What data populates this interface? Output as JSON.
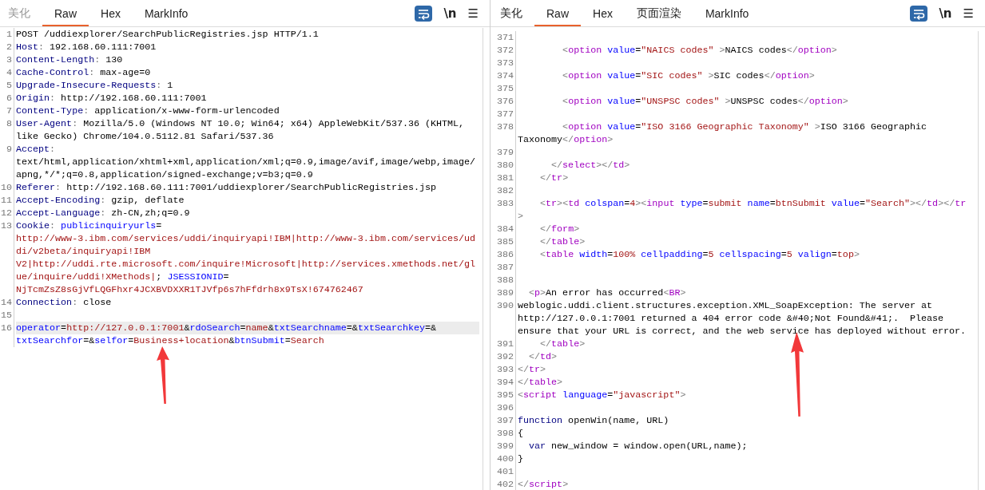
{
  "panes": [
    {
      "tabs": [
        {
          "label": "美化",
          "selected": false,
          "disabled": true
        },
        {
          "label": "Raw",
          "selected": true,
          "disabled": false
        },
        {
          "label": "Hex",
          "selected": false,
          "disabled": false
        },
        {
          "label": "MarkInfo",
          "selected": false,
          "disabled": false
        }
      ],
      "wrap_on": true,
      "newline_label": "\\n",
      "menu_glyph": "☰",
      "top_offset": false,
      "annotation_arrow": true,
      "lines": [
        {
          "number": "1",
          "current": false,
          "rows": [
            {
              "segments": [
                {
                  "text": "POST /uddiexplorer/SearchPublicRegistries.jsp HTTP/1.1",
                  "kind": "plain"
                }
              ]
            }
          ]
        },
        {
          "number": "2",
          "current": false,
          "rows": [
            {
              "segments": [
                {
                  "text": "Host",
                  "kind": "key"
                },
                {
                  "text": ":",
                  "kind": "punct"
                },
                {
                  "text": " 192.168.60.111:7001",
                  "kind": "plain"
                }
              ]
            }
          ]
        },
        {
          "number": "3",
          "current": false,
          "rows": [
            {
              "segments": [
                {
                  "text": "Content-Length",
                  "kind": "key"
                },
                {
                  "text": ":",
                  "kind": "punct"
                },
                {
                  "text": " 130",
                  "kind": "plain"
                }
              ]
            }
          ]
        },
        {
          "number": "4",
          "current": false,
          "rows": [
            {
              "segments": [
                {
                  "text": "Cache-Control",
                  "kind": "key"
                },
                {
                  "text": ":",
                  "kind": "punct"
                },
                {
                  "text": " max-age=0",
                  "kind": "plain"
                }
              ]
            }
          ]
        },
        {
          "number": "5",
          "current": false,
          "rows": [
            {
              "segments": [
                {
                  "text": "Upgrade-Insecure-Requests",
                  "kind": "key"
                },
                {
                  "text": ":",
                  "kind": "punct"
                },
                {
                  "text": " 1",
                  "kind": "plain"
                }
              ]
            }
          ]
        },
        {
          "number": "6",
          "current": false,
          "rows": [
            {
              "segments": [
                {
                  "text": "Origin",
                  "kind": "key"
                },
                {
                  "text": ":",
                  "kind": "punct"
                },
                {
                  "text": " http://192.168.60.111:7001",
                  "kind": "plain"
                }
              ]
            }
          ]
        },
        {
          "number": "7",
          "current": false,
          "rows": [
            {
              "segments": [
                {
                  "text": "Content-Type",
                  "kind": "key"
                },
                {
                  "text": ":",
                  "kind": "punct"
                },
                {
                  "text": " application/x-www-form-urlencoded",
                  "kind": "plain"
                }
              ]
            }
          ]
        },
        {
          "number": "8",
          "current": false,
          "rows": [
            {
              "segments": [
                {
                  "text": "User-Agent",
                  "kind": "key"
                },
                {
                  "text": ":",
                  "kind": "punct"
                },
                {
                  "text": " Mozilla/5.0 (Windows NT 10.0; Win64; x64) AppleWebKit/537.36 (KHTML,",
                  "kind": "plain"
                }
              ]
            },
            {
              "segments": [
                {
                  "text": "like Gecko) Chrome/104.0.5112.81 Safari/537.36",
                  "kind": "plain"
                }
              ]
            }
          ]
        },
        {
          "number": "9",
          "current": false,
          "rows": [
            {
              "segments": [
                {
                  "text": "Accept",
                  "kind": "key"
                },
                {
                  "text": ":",
                  "kind": "punct"
                }
              ]
            },
            {
              "segments": [
                {
                  "text": "text/html,application/xhtml+xml,application/xml;q=0.9,image/avif,image/webp,image/",
                  "kind": "plain"
                }
              ]
            },
            {
              "segments": [
                {
                  "text": "apng,*/*;q=0.8,application/signed-exchange;v=b3;q=0.9",
                  "kind": "plain"
                }
              ]
            }
          ]
        },
        {
          "number": "10",
          "current": false,
          "rows": [
            {
              "segments": [
                {
                  "text": "Referer",
                  "kind": "key"
                },
                {
                  "text": ":",
                  "kind": "punct"
                },
                {
                  "text": " http://192.168.60.111:7001/uddiexplorer/SearchPublicRegistries.jsp",
                  "kind": "plain"
                }
              ]
            }
          ]
        },
        {
          "number": "11",
          "current": false,
          "rows": [
            {
              "segments": [
                {
                  "text": "Accept-Encoding",
                  "kind": "key"
                },
                {
                  "text": ":",
                  "kind": "punct"
                },
                {
                  "text": " gzip, deflate",
                  "kind": "plain"
                }
              ]
            }
          ]
        },
        {
          "number": "12",
          "current": false,
          "rows": [
            {
              "segments": [
                {
                  "text": "Accept-Language",
                  "kind": "key"
                },
                {
                  "text": ":",
                  "kind": "punct"
                },
                {
                  "text": " zh-CN,zh;q=0.9",
                  "kind": "plain"
                }
              ]
            }
          ]
        },
        {
          "number": "13",
          "current": false,
          "rows": [
            {
              "segments": [
                {
                  "text": "Cookie",
                  "kind": "key"
                },
                {
                  "text": ":",
                  "kind": "punct"
                },
                {
                  "text": " publicinquiryurls",
                  "kind": "name"
                },
                {
                  "text": "=",
                  "kind": "plain"
                }
              ]
            },
            {
              "segments": [
                {
                  "text": "http://www-3.ibm.com/services/uddi/inquiryapi!IBM|http://www-3.ibm.com/services/ud",
                  "kind": "value"
                }
              ]
            },
            {
              "segments": [
                {
                  "text": "di/v2beta/inquiryapi!IBM",
                  "kind": "value"
                }
              ]
            },
            {
              "segments": [
                {
                  "text": "V2|http://uddi.rte.microsoft.com/inquire!Microsoft|http://services.xmethods.net/gl",
                  "kind": "value"
                }
              ]
            },
            {
              "segments": [
                {
                  "text": "ue/inquire/uddi!XMethods|",
                  "kind": "value"
                },
                {
                  "text": "; ",
                  "kind": "plain"
                },
                {
                  "text": "JSESSIONID",
                  "kind": "name"
                },
                {
                  "text": "=",
                  "kind": "plain"
                }
              ]
            },
            {
              "segments": [
                {
                  "text": "NjTcmZsZ8sGjVfLQGFhxr4JCXBVDXXR1TJVfp6s7hFfdrh8x9TsX!674762467",
                  "kind": "value"
                }
              ]
            }
          ]
        },
        {
          "number": "14",
          "current": false,
          "rows": [
            {
              "segments": [
                {
                  "text": "Connection",
                  "kind": "key"
                },
                {
                  "text": ":",
                  "kind": "punct"
                },
                {
                  "text": " close",
                  "kind": "plain"
                }
              ]
            }
          ]
        },
        {
          "number": "15",
          "current": false,
          "rows": [
            {}
          ]
        },
        {
          "number": "16",
          "current": true,
          "rows": [
            {
              "segments": [
                {
                  "text": "operator",
                  "kind": "name"
                },
                {
                  "text": "=",
                  "kind": "plain"
                },
                {
                  "text": "http://127.0.0.1:7001",
                  "kind": "value"
                },
                {
                  "text": "&",
                  "kind": "plain"
                },
                {
                  "text": "rdoSearch",
                  "kind": "name"
                },
                {
                  "text": "=",
                  "kind": "plain"
                },
                {
                  "text": "name",
                  "kind": "value"
                },
                {
                  "text": "&",
                  "kind": "plain"
                },
                {
                  "text": "txtSearchname",
                  "kind": "name"
                },
                {
                  "text": "=&",
                  "kind": "plain"
                },
                {
                  "text": "txtSearchkey",
                  "kind": "name"
                },
                {
                  "text": "=&",
                  "kind": "plain"
                }
              ]
            },
            {
              "segments": [
                {
                  "text": "txtSearchfor",
                  "kind": "name"
                },
                {
                  "text": "=&",
                  "kind": "plain"
                },
                {
                  "text": "selfor",
                  "kind": "name"
                },
                {
                  "text": "=",
                  "kind": "plain"
                },
                {
                  "text": "Business+location",
                  "kind": "value"
                },
                {
                  "text": "&",
                  "kind": "plain"
                },
                {
                  "text": "btnSubmit",
                  "kind": "name"
                },
                {
                  "text": "=",
                  "kind": "plain"
                },
                {
                  "text": "Search",
                  "kind": "value"
                }
              ]
            }
          ]
        }
      ]
    },
    {
      "tabs": [
        {
          "label": "美化",
          "selected": false,
          "disabled": false
        },
        {
          "label": "Raw",
          "selected": true,
          "disabled": false
        },
        {
          "label": "Hex",
          "selected": false,
          "disabled": false
        },
        {
          "label": "页面渲染",
          "selected": false,
          "disabled": false
        },
        {
          "label": "MarkInfo",
          "selected": false,
          "disabled": false
        }
      ],
      "wrap_on": true,
      "newline_label": "\\n",
      "menu_glyph": "☰",
      "top_offset": true,
      "annotation_arrow": true,
      "lines": [
        {
          "number": "371",
          "current": false,
          "rows": [
            {}
          ]
        },
        {
          "number": "372",
          "current": false,
          "rows": [
            {
              "segments": [
                {
                  "text": "        <",
                  "kind": "bracket"
                },
                {
                  "text": "option",
                  "kind": "tag"
                },
                {
                  "text": " value",
                  "kind": "attr"
                },
                {
                  "text": "=",
                  "kind": "plain"
                },
                {
                  "text": "\"NAICS codes\"",
                  "kind": "value"
                },
                {
                  "text": " >",
                  "kind": "bracket"
                },
                {
                  "text": "NAICS codes",
                  "kind": "plain"
                },
                {
                  "text": "</",
                  "kind": "bracket"
                },
                {
                  "text": "option",
                  "kind": "tag"
                },
                {
                  "text": ">",
                  "kind": "bracket"
                }
              ]
            }
          ]
        },
        {
          "number": "373",
          "current": false,
          "rows": [
            {}
          ]
        },
        {
          "number": "374",
          "current": false,
          "rows": [
            {
              "segments": [
                {
                  "text": "        <",
                  "kind": "bracket"
                },
                {
                  "text": "option",
                  "kind": "tag"
                },
                {
                  "text": " value",
                  "kind": "attr"
                },
                {
                  "text": "=",
                  "kind": "plain"
                },
                {
                  "text": "\"SIC codes\"",
                  "kind": "value"
                },
                {
                  "text": " >",
                  "kind": "bracket"
                },
                {
                  "text": "SIC codes",
                  "kind": "plain"
                },
                {
                  "text": "</",
                  "kind": "bracket"
                },
                {
                  "text": "option",
                  "kind": "tag"
                },
                {
                  "text": ">",
                  "kind": "bracket"
                }
              ]
            }
          ]
        },
        {
          "number": "375",
          "current": false,
          "rows": [
            {}
          ]
        },
        {
          "number": "376",
          "current": false,
          "rows": [
            {
              "segments": [
                {
                  "text": "        <",
                  "kind": "bracket"
                },
                {
                  "text": "option",
                  "kind": "tag"
                },
                {
                  "text": " value",
                  "kind": "attr"
                },
                {
                  "text": "=",
                  "kind": "plain"
                },
                {
                  "text": "\"UNSPSC codes\"",
                  "kind": "value"
                },
                {
                  "text": " >",
                  "kind": "bracket"
                },
                {
                  "text": "UNSPSC codes",
                  "kind": "plain"
                },
                {
                  "text": "</",
                  "kind": "bracket"
                },
                {
                  "text": "option",
                  "kind": "tag"
                },
                {
                  "text": ">",
                  "kind": "bracket"
                }
              ]
            }
          ]
        },
        {
          "number": "377",
          "current": false,
          "rows": [
            {}
          ]
        },
        {
          "number": "378",
          "current": false,
          "rows": [
            {
              "segments": [
                {
                  "text": "        <",
                  "kind": "bracket"
                },
                {
                  "text": "option",
                  "kind": "tag"
                },
                {
                  "text": " value",
                  "kind": "attr"
                },
                {
                  "text": "=",
                  "kind": "plain"
                },
                {
                  "text": "\"ISO 3166 Geographic Taxonomy\"",
                  "kind": "value"
                },
                {
                  "text": " >",
                  "kind": "bracket"
                },
                {
                  "text": "ISO 3166 Geographic",
                  "kind": "plain"
                }
              ]
            },
            {
              "segments": [
                {
                  "text": "Taxonomy",
                  "kind": "plain"
                },
                {
                  "text": "</",
                  "kind": "bracket"
                },
                {
                  "text": "option",
                  "kind": "tag"
                },
                {
                  "text": ">",
                  "kind": "bracket"
                }
              ]
            }
          ]
        },
        {
          "number": "379",
          "current": false,
          "rows": [
            {}
          ]
        },
        {
          "number": "380",
          "current": false,
          "rows": [
            {
              "segments": [
                {
                  "text": "      </",
                  "kind": "bracket"
                },
                {
                  "text": "select",
                  "kind": "tag"
                },
                {
                  "text": ">",
                  "kind": "bracket"
                },
                {
                  "text": "</",
                  "kind": "bracket"
                },
                {
                  "text": "td",
                  "kind": "tag"
                },
                {
                  "text": ">",
                  "kind": "bracket"
                }
              ]
            }
          ]
        },
        {
          "number": "381",
          "current": false,
          "rows": [
            {
              "segments": [
                {
                  "text": "    </",
                  "kind": "bracket"
                },
                {
                  "text": "tr",
                  "kind": "tag"
                },
                {
                  "text": ">",
                  "kind": "bracket"
                }
              ]
            }
          ]
        },
        {
          "number": "382",
          "current": false,
          "rows": [
            {}
          ]
        },
        {
          "number": "383",
          "current": false,
          "rows": [
            {
              "segments": [
                {
                  "text": "    <",
                  "kind": "bracket"
                },
                {
                  "text": "tr",
                  "kind": "tag"
                },
                {
                  "text": ">",
                  "kind": "bracket"
                },
                {
                  "text": "<",
                  "kind": "bracket"
                },
                {
                  "text": "td",
                  "kind": "tag"
                },
                {
                  "text": " colspan",
                  "kind": "attr"
                },
                {
                  "text": "=",
                  "kind": "plain"
                },
                {
                  "text": "4",
                  "kind": "value"
                },
                {
                  "text": ">",
                  "kind": "bracket"
                },
                {
                  "text": "<",
                  "kind": "bracket"
                },
                {
                  "text": "input",
                  "kind": "tag"
                },
                {
                  "text": " type",
                  "kind": "attr"
                },
                {
                  "text": "=",
                  "kind": "plain"
                },
                {
                  "text": "submit",
                  "kind": "value"
                },
                {
                  "text": " name",
                  "kind": "attr"
                },
                {
                  "text": "=",
                  "kind": "plain"
                },
                {
                  "text": "btnSubmit",
                  "kind": "value"
                },
                {
                  "text": " value",
                  "kind": "attr"
                },
                {
                  "text": "=",
                  "kind": "plain"
                },
                {
                  "text": "\"Search\"",
                  "kind": "value"
                },
                {
                  "text": ">",
                  "kind": "bracket"
                },
                {
                  "text": "</",
                  "kind": "bracket"
                },
                {
                  "text": "td",
                  "kind": "tag"
                },
                {
                  "text": ">",
                  "kind": "bracket"
                },
                {
                  "text": "</",
                  "kind": "bracket"
                },
                {
                  "text": "tr",
                  "kind": "tag"
                }
              ]
            },
            {
              "segments": [
                {
                  "text": ">",
                  "kind": "bracket"
                }
              ]
            }
          ]
        },
        {
          "number": "384",
          "current": false,
          "rows": [
            {
              "segments": [
                {
                  "text": "    </",
                  "kind": "bracket"
                },
                {
                  "text": "form",
                  "kind": "tag"
                },
                {
                  "text": ">",
                  "kind": "bracket"
                }
              ]
            }
          ]
        },
        {
          "number": "385",
          "current": false,
          "rows": [
            {
              "segments": [
                {
                  "text": "    </",
                  "kind": "bracket"
                },
                {
                  "text": "table",
                  "kind": "tag"
                },
                {
                  "text": ">",
                  "kind": "bracket"
                }
              ]
            }
          ]
        },
        {
          "number": "386",
          "current": false,
          "rows": [
            {
              "segments": [
                {
                  "text": "    <",
                  "kind": "bracket"
                },
                {
                  "text": "table",
                  "kind": "tag"
                },
                {
                  "text": " width",
                  "kind": "attr"
                },
                {
                  "text": "=",
                  "kind": "plain"
                },
                {
                  "text": "100%",
                  "kind": "value"
                },
                {
                  "text": " cellpadding",
                  "kind": "attr"
                },
                {
                  "text": "=",
                  "kind": "plain"
                },
                {
                  "text": "5",
                  "kind": "value"
                },
                {
                  "text": " cellspacing",
                  "kind": "attr"
                },
                {
                  "text": "=",
                  "kind": "plain"
                },
                {
                  "text": "5",
                  "kind": "value"
                },
                {
                  "text": " valign",
                  "kind": "attr"
                },
                {
                  "text": "=",
                  "kind": "plain"
                },
                {
                  "text": "top",
                  "kind": "value"
                },
                {
                  "text": ">",
                  "kind": "bracket"
                }
              ]
            }
          ]
        },
        {
          "number": "387",
          "current": false,
          "rows": [
            {}
          ]
        },
        {
          "number": "388",
          "current": false,
          "rows": [
            {}
          ]
        },
        {
          "number": "389",
          "current": false,
          "rows": [
            {
              "segments": [
                {
                  "text": "  <",
                  "kind": "bracket"
                },
                {
                  "text": "p",
                  "kind": "tag"
                },
                {
                  "text": ">",
                  "kind": "bracket"
                },
                {
                  "text": "An error has occurred",
                  "kind": "plain"
                },
                {
                  "text": "<",
                  "kind": "bracket"
                },
                {
                  "text": "BR",
                  "kind": "tag"
                },
                {
                  "text": ">",
                  "kind": "bracket"
                }
              ]
            }
          ]
        },
        {
          "number": "390",
          "current": false,
          "rows": [
            {
              "segments": [
                {
                  "text": "weblogic.uddi.client.structures.exception.XML_SoapException: The server at",
                  "kind": "plain"
                }
              ]
            },
            {
              "segments": [
                {
                  "text": "http://127.0.0.1:7001 returned a 404 error code &#40;Not Found&#41;.  Please",
                  "kind": "plain"
                }
              ]
            },
            {
              "segments": [
                {
                  "text": "ensure that your URL is correct, and the web service has deployed without error.",
                  "kind": "plain"
                }
              ]
            }
          ]
        },
        {
          "number": "391",
          "current": false,
          "rows": [
            {
              "segments": [
                {
                  "text": "    </",
                  "kind": "bracket"
                },
                {
                  "text": "table",
                  "kind": "tag"
                },
                {
                  "text": ">",
                  "kind": "bracket"
                }
              ]
            }
          ]
        },
        {
          "number": "392",
          "current": false,
          "rows": [
            {
              "segments": [
                {
                  "text": "  </",
                  "kind": "bracket"
                },
                {
                  "text": "td",
                  "kind": "tag"
                },
                {
                  "text": ">",
                  "kind": "bracket"
                }
              ]
            }
          ]
        },
        {
          "number": "393",
          "current": false,
          "rows": [
            {
              "segments": [
                {
                  "text": "</",
                  "kind": "bracket"
                },
                {
                  "text": "tr",
                  "kind": "tag"
                },
                {
                  "text": ">",
                  "kind": "bracket"
                }
              ]
            }
          ]
        },
        {
          "number": "394",
          "current": false,
          "rows": [
            {
              "segments": [
                {
                  "text": "</",
                  "kind": "bracket"
                },
                {
                  "text": "table",
                  "kind": "tag"
                },
                {
                  "text": ">",
                  "kind": "bracket"
                }
              ]
            }
          ]
        },
        {
          "number": "395",
          "current": false,
          "rows": [
            {
              "segments": [
                {
                  "text": "<",
                  "kind": "bracket"
                },
                {
                  "text": "script",
                  "kind": "tag"
                },
                {
                  "text": " language",
                  "kind": "attr"
                },
                {
                  "text": "=",
                  "kind": "plain"
                },
                {
                  "text": "\"javascript\"",
                  "kind": "value"
                },
                {
                  "text": ">",
                  "kind": "bracket"
                }
              ]
            }
          ]
        },
        {
          "number": "396",
          "current": false,
          "rows": [
            {}
          ]
        },
        {
          "number": "397",
          "current": false,
          "rows": [
            {
              "segments": [
                {
                  "text": "function",
                  "kind": "key"
                },
                {
                  "text": " openWin(name, URL)",
                  "kind": "plain"
                }
              ]
            }
          ]
        },
        {
          "number": "398",
          "current": false,
          "rows": [
            {
              "segments": [
                {
                  "text": "{",
                  "kind": "plain"
                }
              ]
            }
          ]
        },
        {
          "number": "399",
          "current": false,
          "rows": [
            {
              "segments": [
                {
                  "text": "  var",
                  "kind": "key"
                },
                {
                  "text": " new_window = window.open(URL,name);",
                  "kind": "plain"
                }
              ]
            }
          ]
        },
        {
          "number": "400",
          "current": false,
          "rows": [
            {
              "segments": [
                {
                  "text": "}",
                  "kind": "plain"
                }
              ]
            }
          ]
        },
        {
          "number": "401",
          "current": false,
          "rows": [
            {}
          ]
        },
        {
          "number": "402",
          "current": false,
          "rows": [
            {
              "segments": [
                {
                  "text": "</",
                  "kind": "bracket"
                },
                {
                  "text": "script",
                  "kind": "tag"
                },
                {
                  "text": ">",
                  "kind": "bracket"
                }
              ]
            }
          ]
        }
      ]
    }
  ]
}
